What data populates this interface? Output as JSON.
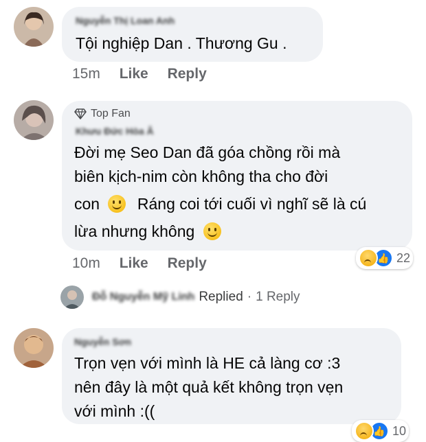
{
  "comments": [
    {
      "author": "Nguyễn Thị Loan Anh",
      "lines": [
        "Tội nghiệp Dan . Thương Gu ."
      ],
      "time": "15m",
      "like_label": "Like",
      "reply_label": "Reply"
    },
    {
      "badge": "Top Fan",
      "author": "Khưu Đức Hòa Â",
      "lines": [
        "Đời mẹ Seo Dan đã góa chồng rồi mà",
        "biên kịch-nim còn không tha cho đời",
        "con",
        "Ráng coi tới cuối vì nghĩ sẽ là cú",
        "lừa nhưng không"
      ],
      "time": "10m",
      "like_label": "Like",
      "reply_label": "Reply",
      "reaction_count": "22",
      "replies": {
        "replier": "Đỗ Nguyễn Mỹ Linh",
        "replied_label": "Replied",
        "separator": "·",
        "count_label": "1 Reply"
      }
    },
    {
      "author": "Nguyễn Sơn",
      "lines": [
        "Trọn vẹn với mình là HE cả làng cơ :3",
        "nên đây là một quả kết không trọn vẹn",
        "với mình :(("
      ],
      "reaction_count": "10"
    }
  ],
  "colors": {
    "bubble": "#f0f2f5",
    "meta": "#65676b",
    "like_blue": "#1877f2"
  }
}
